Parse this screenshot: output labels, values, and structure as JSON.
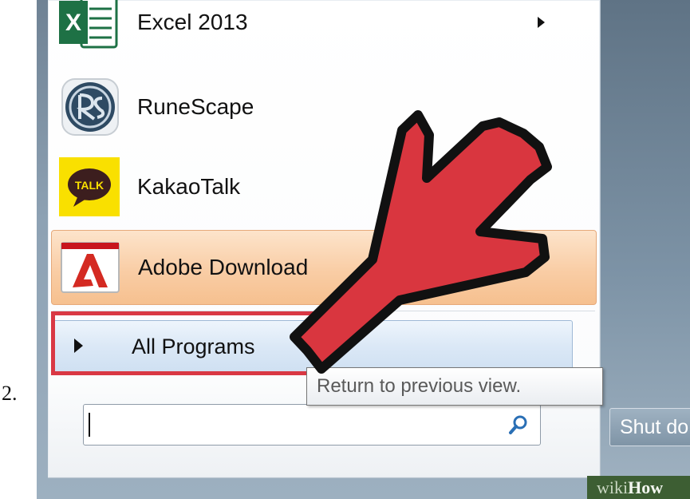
{
  "step": {
    "number": "2."
  },
  "start_menu": {
    "programs": [
      {
        "label": "Excel 2013",
        "icon": "excel-icon",
        "has_submenu": true,
        "icon_text": "X"
      },
      {
        "label": "RuneScape",
        "icon": "runescape-icon"
      },
      {
        "label": "KakaoTalk",
        "icon": "kakaotalk-icon",
        "icon_text": "TALK"
      },
      {
        "label": "Adobe Download",
        "icon": "adobe-icon",
        "highlighted": true
      }
    ],
    "all_programs": {
      "label": "All Programs"
    },
    "tooltip": "Return to previous view.",
    "search": {
      "value": "",
      "placeholder": ""
    },
    "shutdown": {
      "label": "Shut do"
    }
  },
  "watermark": {
    "part1": "wiki",
    "part2": "How"
  },
  "colors": {
    "annotation_red": "#d93844",
    "hover_orange": "#f9cda5",
    "all_programs_blue": "#dbe8f6",
    "excel_green": "#1e7145",
    "kakao_yellow": "#f9e000"
  }
}
